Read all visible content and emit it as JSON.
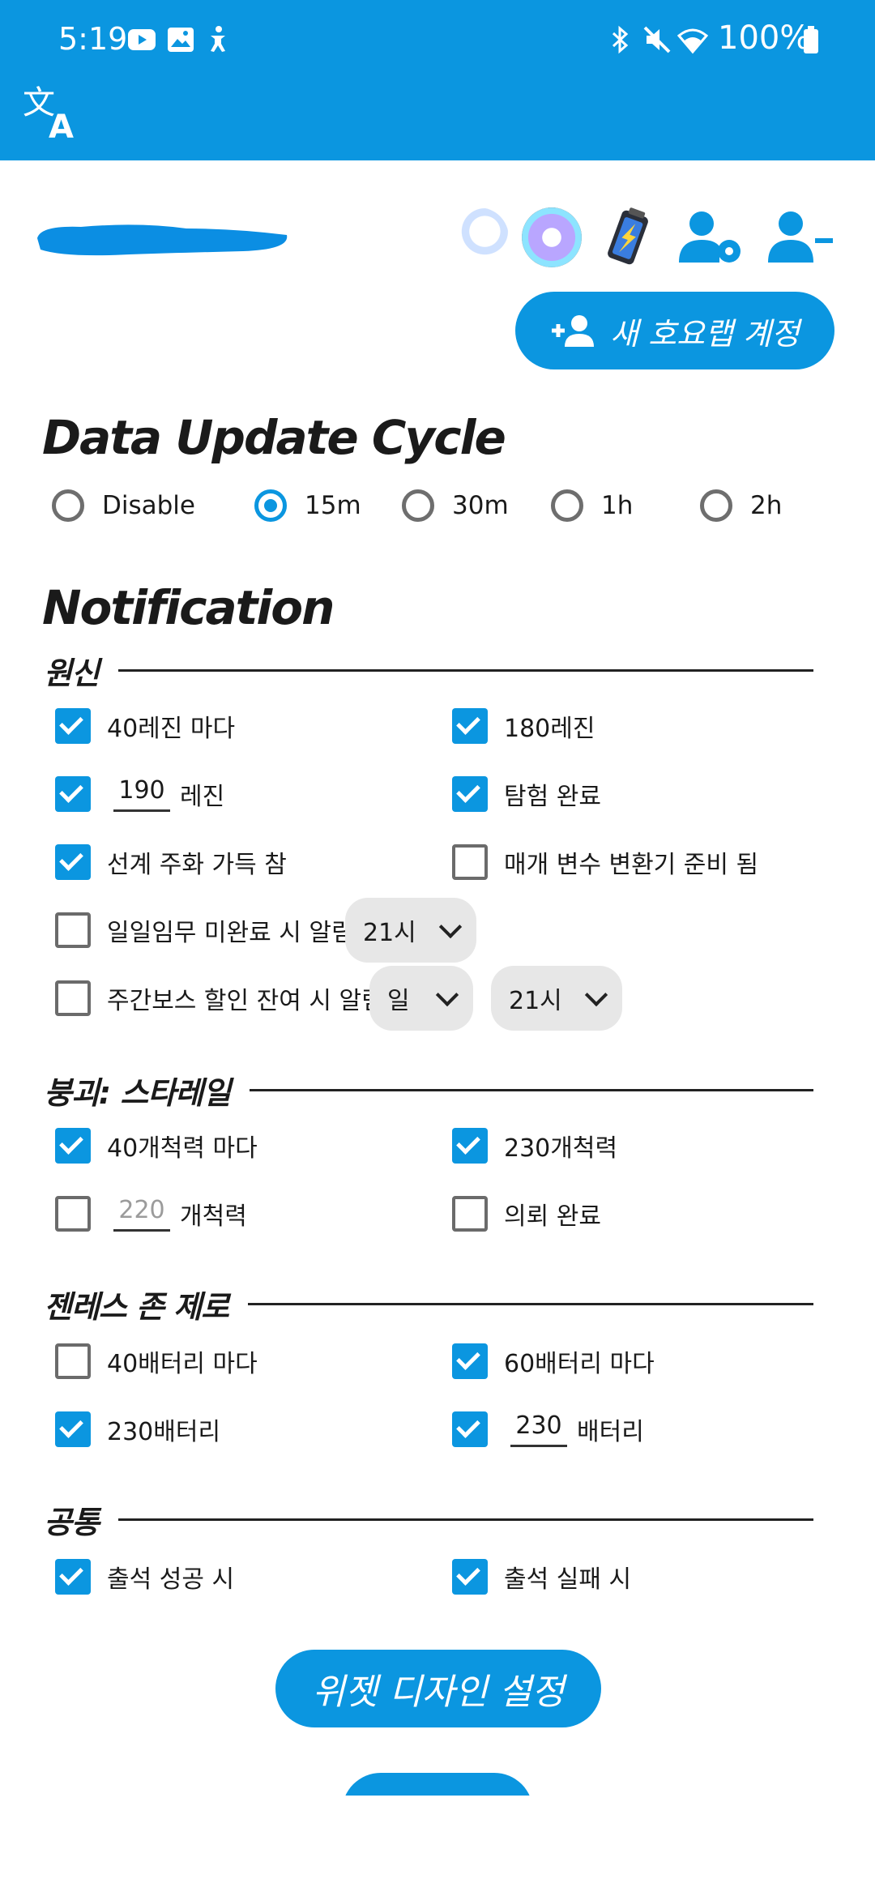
{
  "status_bar": {
    "time": "5:19",
    "battery": "100%"
  },
  "account": {
    "new_account_label": "새 호요랩 계정"
  },
  "update_cycle": {
    "title": "Data Update Cycle",
    "options": [
      "Disable",
      "15m",
      "30m",
      "1h",
      "2h"
    ],
    "selected": "15m"
  },
  "notification": {
    "title": "Notification",
    "genshin": {
      "label": "원신",
      "every_40_resin": "40레진 마다",
      "resin_180": "180레진",
      "custom_resin_value": "190",
      "custom_resin_unit": "레진",
      "expedition_done": "탐험 완료",
      "realm_currency_full": "선계 주화 가득 참",
      "transformer_ready": "매개 변수 변환기 준비 됨",
      "daily_reminder": "일일임무 미완료 시 알림",
      "daily_hour": "21시",
      "weekly_boss_reminder": "주간보스 할인 잔여 시 알림",
      "weekly_day": "일",
      "weekly_hour": "21시"
    },
    "starrail": {
      "label": "붕괴: 스타레일",
      "every_40_power": "40개척력 마다",
      "power_230": "230개척력",
      "custom_power_value": "220",
      "custom_power_unit": "개척력",
      "commission_done": "의뢰 완료"
    },
    "zzz": {
      "label": "젠레스 존 제로",
      "every_40_battery": "40배터리 마다",
      "every_60_battery": "60배터리 마다",
      "battery_230": "230배터리",
      "custom_battery_value": "230",
      "custom_battery_unit": "배터리"
    },
    "common": {
      "label": "공통",
      "checkin_success": "출석 성공 시",
      "checkin_fail": "출석 실패 시"
    }
  },
  "widget_design_button": "위젯 디자인 설정",
  "colors": {
    "accent": "#0b96e0"
  }
}
